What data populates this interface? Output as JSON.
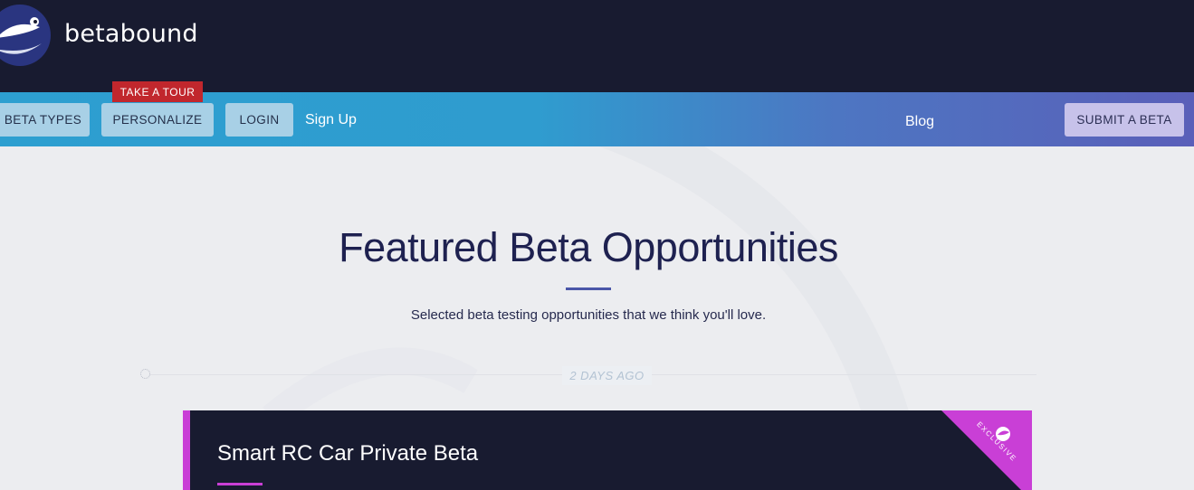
{
  "brand": {
    "name": "betabound",
    "logo_icon": "fish-logo-icon"
  },
  "nav": {
    "beta_types": "BETA TYPES",
    "personalize": "PERSONALIZE",
    "take_a_tour": "TAKE A TOUR",
    "login": "LOGIN",
    "sign_up": "Sign Up",
    "blog": "Blog",
    "submit_a_beta": "SUBMIT A BETA"
  },
  "hero": {
    "title": "Featured Beta Opportunities",
    "subtitle": "Selected beta testing opportunities that we think you'll love."
  },
  "feed": {
    "date_label": "2 DAYS AGO",
    "cards": [
      {
        "title": "Smart RC Car Private Beta",
        "ribbon": "EXCLUSIVE",
        "ribbon_icon": "fish-badge-icon"
      }
    ]
  },
  "colors": {
    "header_bg": "#181b30",
    "nav_gradient_start": "#2d9fd0",
    "nav_gradient_end": "#5a5fb9",
    "accent_red": "#c1272d",
    "accent_magenta": "#c93fd6",
    "title_navy": "#1e2150"
  }
}
